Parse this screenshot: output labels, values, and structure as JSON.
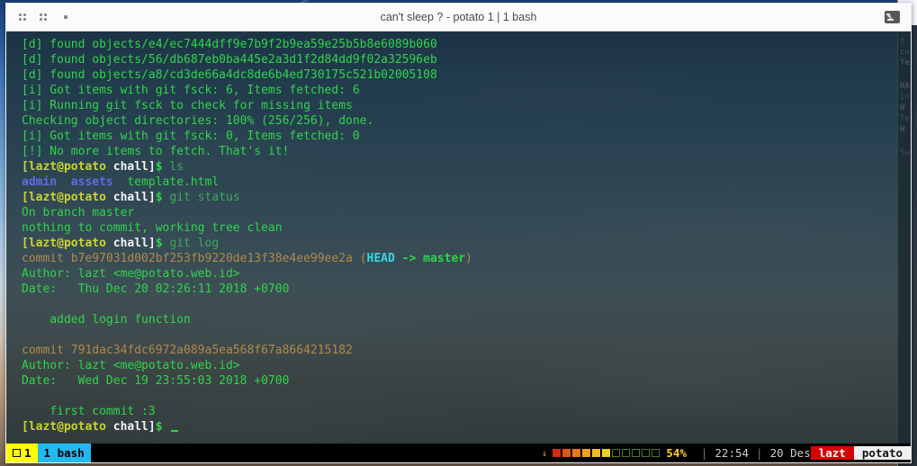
{
  "window": {
    "title": "can't sleep ? - potato 1 | 1 bash",
    "titlebar_icons": [
      "grid-dots-icon",
      "grid-dots-icon",
      "dot-icon"
    ],
    "right_icon": "terminal-icon"
  },
  "terminal": {
    "lines": [
      {
        "id": "l1",
        "segments": [
          {
            "text": "[d] found objects/e4/ec7444dff9e7b9f2b9ea59e25b5b8e6089b060",
            "class": "g"
          }
        ]
      },
      {
        "id": "l2",
        "segments": [
          {
            "text": "[d] found objects/56/db687eb0ba445e2a3d1f2d84dd9f02a32596eb",
            "class": "g"
          }
        ]
      },
      {
        "id": "l3",
        "segments": [
          {
            "text": "[d] found objects/a8/cd3de66a4dc8de6b4ed730175c521b02005108",
            "class": "g"
          }
        ]
      },
      {
        "id": "l4",
        "segments": [
          {
            "text": "[i] Got items with git fsck: 6, Items fetched: 6",
            "class": "g"
          }
        ]
      },
      {
        "id": "l5",
        "segments": [
          {
            "text": "[i] Running git fsck to check for missing items",
            "class": "g"
          }
        ]
      },
      {
        "id": "l6",
        "segments": [
          {
            "text": "Checking object directories: 100% (256/256), done.",
            "class": "g"
          }
        ]
      },
      {
        "id": "l7",
        "segments": [
          {
            "text": "[i] Got items with git fsck: 0, Items fetched: 0",
            "class": "g"
          }
        ]
      },
      {
        "id": "l8",
        "segments": [
          {
            "text": "[!] No more items to fetch. That's it!",
            "class": "g"
          }
        ]
      },
      {
        "id": "l9",
        "segments": [
          {
            "text": "[lazt@potato",
            "class": "user"
          },
          {
            "text": " ",
            "class": "g"
          },
          {
            "text": "chall]",
            "class": "host"
          },
          {
            "text": "$",
            "class": "dollar"
          },
          {
            "text": " ls",
            "class": "cmd"
          }
        ]
      },
      {
        "id": "l10",
        "segments": [
          {
            "text": "admin",
            "class": "dir"
          },
          {
            "text": "  ",
            "class": "g"
          },
          {
            "text": "assets",
            "class": "dir"
          },
          {
            "text": "  template.html",
            "class": "g"
          }
        ]
      },
      {
        "id": "l11",
        "segments": [
          {
            "text": "[lazt@potato",
            "class": "user"
          },
          {
            "text": " ",
            "class": "g"
          },
          {
            "text": "chall]",
            "class": "host"
          },
          {
            "text": "$",
            "class": "dollar"
          },
          {
            "text": " git status",
            "class": "cmd"
          }
        ]
      },
      {
        "id": "l12",
        "segments": [
          {
            "text": "On branch master",
            "class": "g"
          }
        ]
      },
      {
        "id": "l13",
        "segments": [
          {
            "text": "nothing to commit, working tree clean",
            "class": "g"
          }
        ]
      },
      {
        "id": "l14",
        "segments": [
          {
            "text": "[lazt@potato",
            "class": "user"
          },
          {
            "text": " ",
            "class": "g"
          },
          {
            "text": "chall]",
            "class": "host"
          },
          {
            "text": "$",
            "class": "dollar"
          },
          {
            "text": " git log",
            "class": "cmd"
          }
        ]
      },
      {
        "id": "l15",
        "segments": [
          {
            "text": "commit b7e97031d002bf253fb9220de13f38e4ee99ee2a ",
            "class": "commit"
          },
          {
            "text": "(",
            "class": "paren"
          },
          {
            "text": "HEAD",
            "class": "cyan"
          },
          {
            "text": " -> ",
            "class": "gb"
          },
          {
            "text": "master",
            "class": "gb"
          },
          {
            "text": ")",
            "class": "paren"
          }
        ]
      },
      {
        "id": "l16",
        "segments": [
          {
            "text": "Author: lazt <me@potato.web.id>",
            "class": "g"
          }
        ]
      },
      {
        "id": "l17",
        "segments": [
          {
            "text": "Date:   Thu Dec 20 02:26:11 2018 +0700",
            "class": "g"
          }
        ]
      },
      {
        "id": "l18",
        "segments": [
          {
            "text": "",
            "class": "g"
          }
        ]
      },
      {
        "id": "l19",
        "segments": [
          {
            "text": "    added login function",
            "class": "g"
          }
        ]
      },
      {
        "id": "l20",
        "segments": [
          {
            "text": "",
            "class": "g"
          }
        ]
      },
      {
        "id": "l21",
        "segments": [
          {
            "text": "commit 791dac34fdc6972a089a5ea568f67a8664215182",
            "class": "commit"
          }
        ]
      },
      {
        "id": "l22",
        "segments": [
          {
            "text": "Author: lazt <me@potato.web.id>",
            "class": "g"
          }
        ]
      },
      {
        "id": "l23",
        "segments": [
          {
            "text": "Date:   Wed Dec 19 23:55:03 2018 +0700",
            "class": "g"
          }
        ]
      },
      {
        "id": "l24",
        "segments": [
          {
            "text": "",
            "class": "g"
          }
        ]
      },
      {
        "id": "l25",
        "segments": [
          {
            "text": "    first commit :3",
            "class": "g"
          }
        ]
      },
      {
        "id": "l26",
        "segments": [
          {
            "text": "[lazt@potato",
            "class": "user"
          },
          {
            "text": " ",
            "class": "g"
          },
          {
            "text": "chall]",
            "class": "host"
          },
          {
            "text": "$",
            "class": "dollar"
          },
          {
            "text": " ",
            "class": "cmd"
          }
        ],
        "cursor": true
      }
    ]
  },
  "statusbar": {
    "window_active_index": "1",
    "window_active_icon": "square-icon",
    "window_bash": "1 bash",
    "battery_icon": "down-arrow-icon",
    "battery_filled_colors": [
      "#d32b16",
      "#e0561a",
      "#e9781c",
      "#efa01f",
      "#f2bb1f",
      "#e8d420"
    ],
    "battery_empty_count": 5,
    "battery_percent": "54%",
    "separator": "|",
    "time": "22:54",
    "date": "20 Des",
    "user": "lazt",
    "host": "potato",
    "colors": {
      "active_window_bg": "#ffff00",
      "window_bg": "#22b8f0",
      "user_bg": "#d60000",
      "host_bg": "#f0f0f0",
      "percent_fg": "#ffd21e"
    }
  },
  "background_window": {
    "lines": [
      "o",
      "o",
      "co",
      "Te",
      "RA",
      "in",
      "W",
      "Te",
      "W",
      "Su"
    ]
  }
}
